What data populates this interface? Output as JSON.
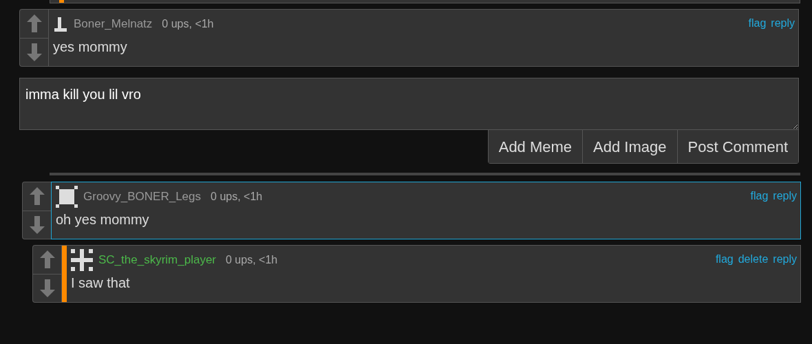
{
  "comments": [
    {
      "username": "Boner_Melnatz",
      "color": "#999999",
      "meta": "0 ups, <1h",
      "body": "yes mommy",
      "highlighted": false,
      "mod_bar": false,
      "actions": [
        "flag",
        "reply"
      ]
    }
  ],
  "reply_form": {
    "value": "imma kill you lil vro",
    "buttons": [
      "Add Meme",
      "Add Image",
      "Post Comment"
    ]
  },
  "thread": [
    {
      "username": "Groovy_BONER_Legs",
      "color": "#999999",
      "meta": "0 ups, <1h",
      "body": "oh yes mommy",
      "highlighted": true,
      "mod_bar": false,
      "actions": [
        "flag",
        "reply"
      ],
      "children": [
        {
          "username": "SC_the_skyrim_player",
          "color": "#4cb84a",
          "meta": "0 ups, <1h",
          "body": "I saw that",
          "highlighted": false,
          "mod_bar": true,
          "actions": [
            "flag",
            "delete",
            "reply"
          ]
        }
      ]
    }
  ]
}
